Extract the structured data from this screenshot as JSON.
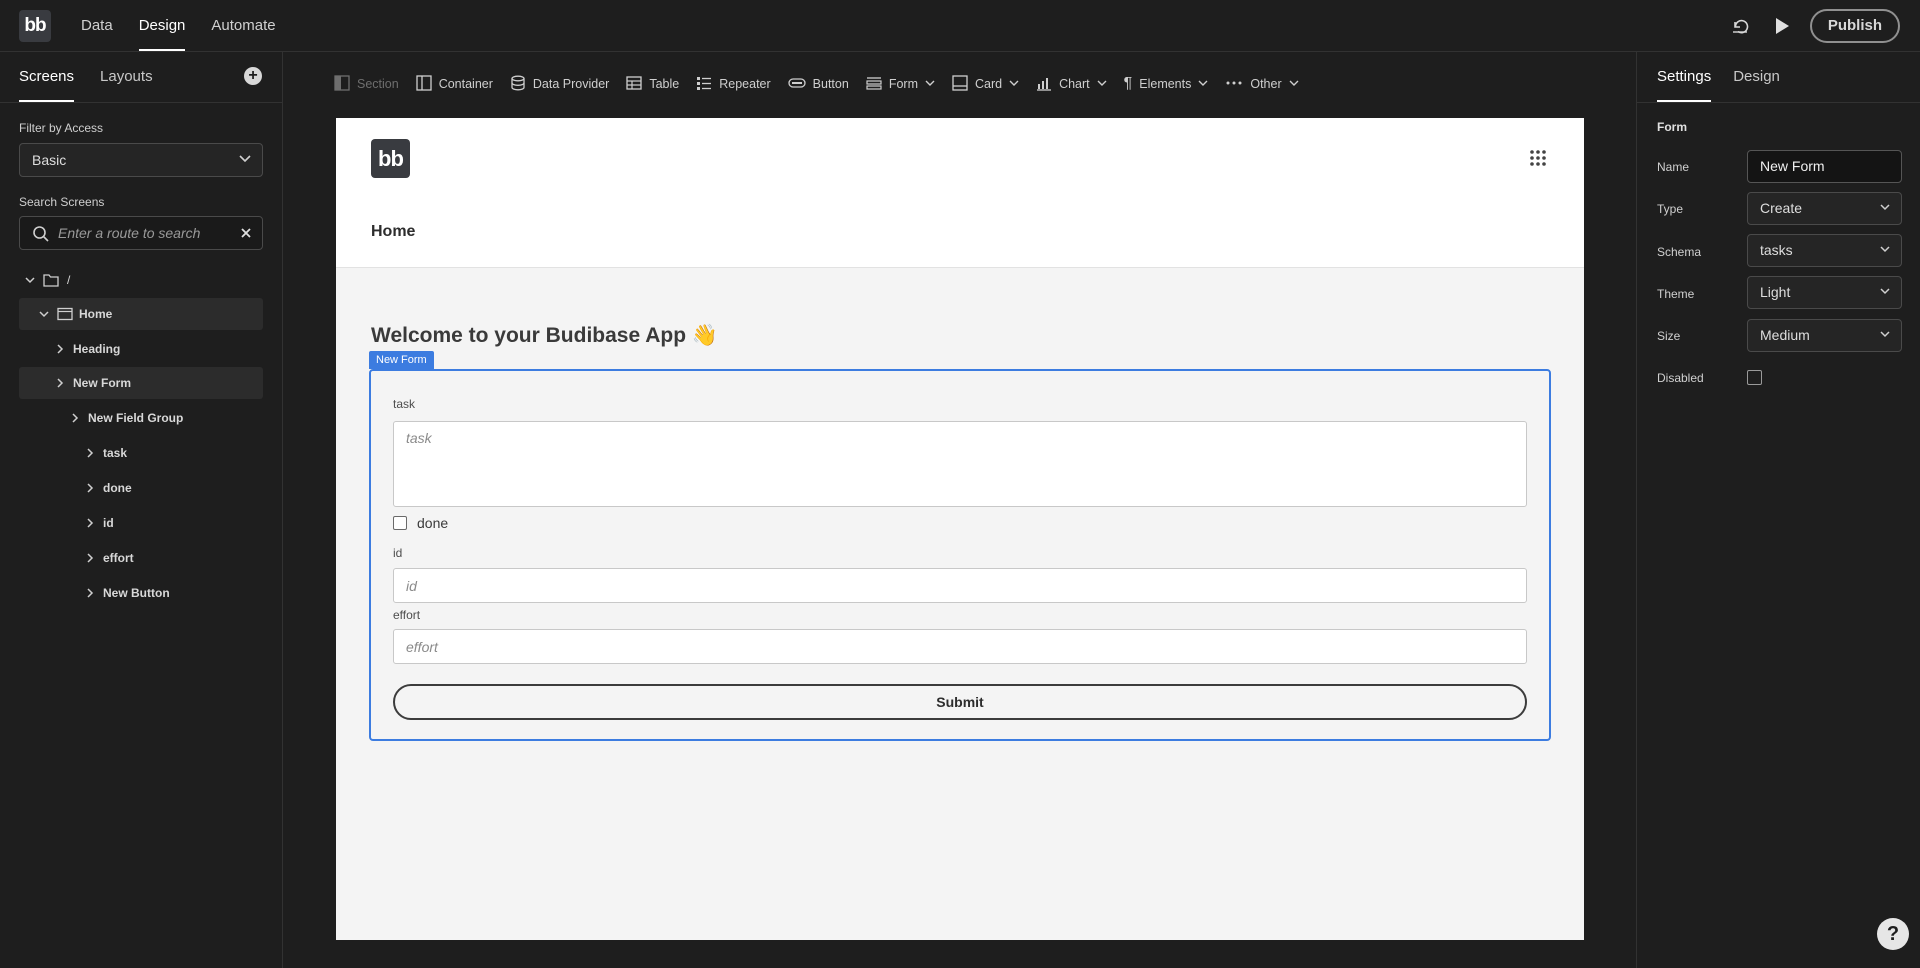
{
  "app": {
    "logo_text": "bb",
    "nav": [
      "Data",
      "Design",
      "Automate"
    ],
    "active_nav": "Design",
    "publish_label": "Publish"
  },
  "left": {
    "tabs": [
      "Screens",
      "Layouts"
    ],
    "filter_label": "Filter by Access",
    "filter_value": "Basic",
    "search_label": "Search Screens",
    "search_placeholder": "Enter a route to search",
    "tree": [
      {
        "label": "/",
        "level": 0,
        "icon": "folder-icon",
        "open": true
      },
      {
        "label": "Home",
        "level": 1,
        "icon": "screen-icon",
        "open": true,
        "selected": true
      },
      {
        "label": "Heading",
        "level": 2
      },
      {
        "label": "New Form",
        "level": 2,
        "selected": true
      },
      {
        "label": "New Field Group",
        "level": 3
      },
      {
        "label": "task",
        "level": 4
      },
      {
        "label": "done",
        "level": 4
      },
      {
        "label": "id",
        "level": 4
      },
      {
        "label": "effort",
        "level": 4
      },
      {
        "label": "New Button",
        "level": 4
      }
    ]
  },
  "toolbar": {
    "items": [
      {
        "label": "Section",
        "icon": "section-icon",
        "disabled": true
      },
      {
        "label": "Container",
        "icon": "container-icon"
      },
      {
        "label": "Data Provider",
        "icon": "database-icon"
      },
      {
        "label": "Table",
        "icon": "table-icon"
      },
      {
        "label": "Repeater",
        "icon": "list-icon"
      },
      {
        "label": "Button",
        "icon": "button-icon"
      },
      {
        "label": "Form",
        "icon": "form-icon",
        "dropdown": true
      },
      {
        "label": "Card",
        "icon": "card-icon",
        "dropdown": true
      },
      {
        "label": "Chart",
        "icon": "chart-icon",
        "dropdown": true
      },
      {
        "label": "Elements",
        "icon": "paragraph-icon",
        "dropdown": true
      },
      {
        "label": "Other",
        "icon": "more-icon",
        "dropdown": true
      }
    ]
  },
  "preview": {
    "logo_text": "bb",
    "nav_home": "Home",
    "heading": "Welcome to your Budibase App 👋",
    "form_badge": "New Form",
    "fields": {
      "task_label": "task",
      "task_placeholder": "task",
      "done_label": "done",
      "id_label": "id",
      "id_placeholder": "id",
      "effort_label": "effort",
      "effort_placeholder": "effort"
    },
    "submit_label": "Submit"
  },
  "right": {
    "tabs": [
      "Settings",
      "Design"
    ],
    "section": "Form",
    "name_label": "Name",
    "name_value": "New Form",
    "type_label": "Type",
    "type_value": "Create",
    "schema_label": "Schema",
    "schema_value": "tasks",
    "theme_label": "Theme",
    "theme_value": "Light",
    "size_label": "Size",
    "size_value": "Medium",
    "disabled_label": "Disabled"
  }
}
